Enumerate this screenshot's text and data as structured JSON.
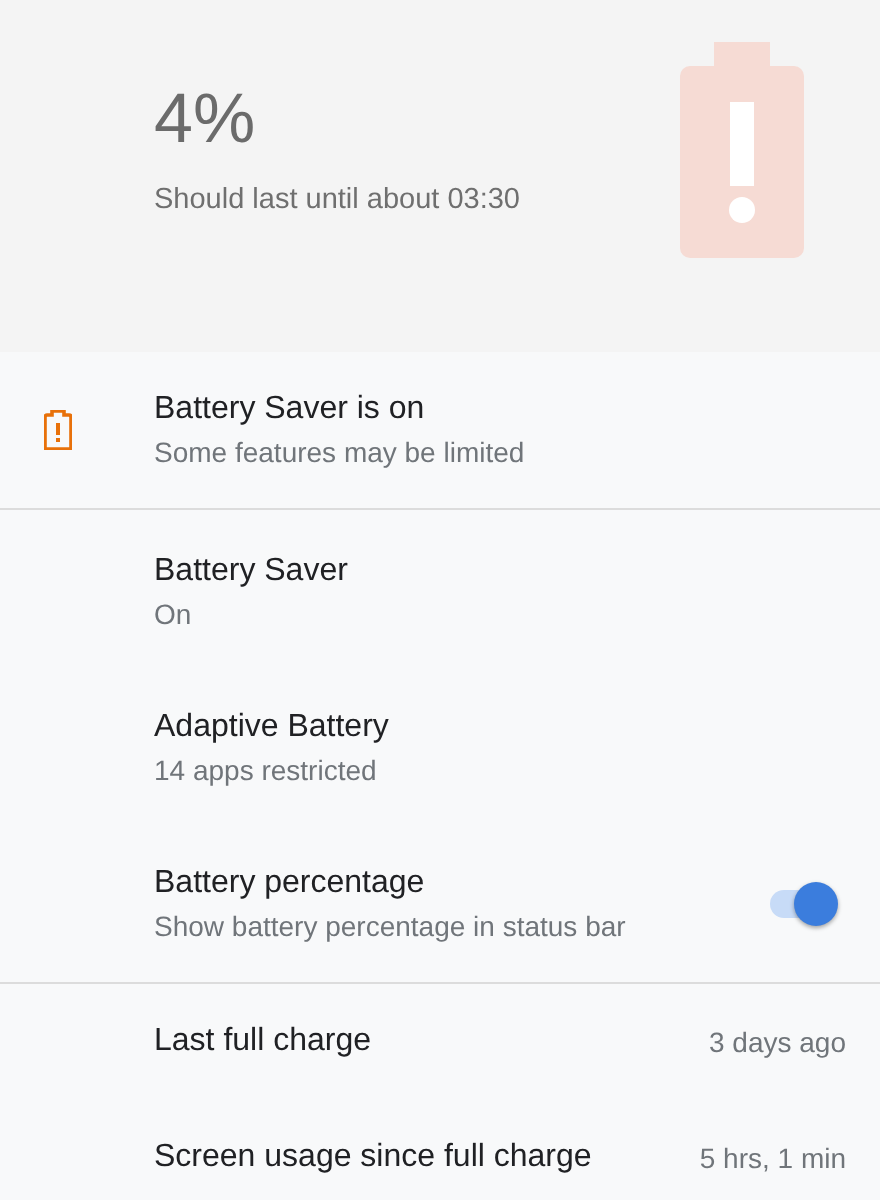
{
  "header": {
    "percent": "4%",
    "estimate": "Should last until about 03:30"
  },
  "alert": {
    "title": "Battery Saver is on",
    "summary": "Some features may be limited"
  },
  "settings": [
    {
      "kind": "item",
      "title": "Battery Saver",
      "summary": "On"
    },
    {
      "kind": "item",
      "title": "Adaptive Battery",
      "summary": "14 apps restricted"
    },
    {
      "kind": "toggle",
      "title": "Battery percentage",
      "summary": "Show battery percentage in status bar",
      "on": true
    }
  ],
  "stats": [
    {
      "label": "Last full charge",
      "value": "3 days ago"
    },
    {
      "label": "Screen usage since full charge",
      "value": "5 hrs, 1 min"
    }
  ]
}
